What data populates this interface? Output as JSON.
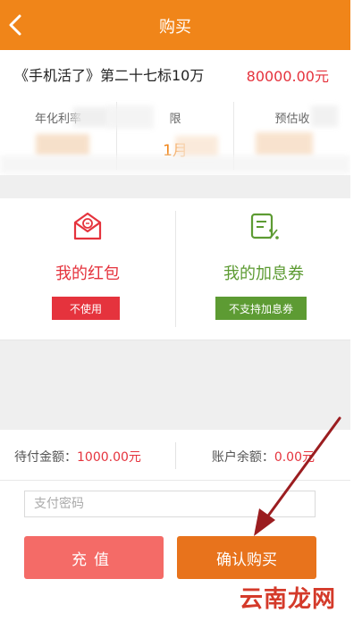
{
  "header": {
    "title": "购买"
  },
  "product": {
    "name": "《手机活了》第二十七标10万",
    "amount": "80000.00元"
  },
  "stats": {
    "items": [
      {
        "label": "年化利率",
        "value": ""
      },
      {
        "label": "限",
        "value": "1月"
      },
      {
        "label": "预估收",
        "value": ""
      }
    ]
  },
  "cards": {
    "red_packet": {
      "title": "我的红包",
      "button": "不使用",
      "color": "#e5333d"
    },
    "coupon": {
      "title": "我的加息券",
      "button": "不支持加息券",
      "color": "#5d9b33"
    }
  },
  "payment": {
    "due_label": "待付金额：",
    "due_value": "1000.00元",
    "balance_label": "账户余额：",
    "balance_value": "0.00元",
    "password_placeholder": "支付密码",
    "recharge_label": "充值",
    "confirm_label": "确认购买"
  },
  "watermark": {
    "text": "云南龙网"
  },
  "colors": {
    "brand_orange": "#f08519",
    "accent_red": "#e5333d",
    "accent_green": "#5d9b33",
    "annotation_arrow": "#9b1d20"
  },
  "icons": {
    "back": "chevron-left-icon",
    "red_packet": "envelope-icon",
    "coupon": "coupon-percent-icon"
  }
}
